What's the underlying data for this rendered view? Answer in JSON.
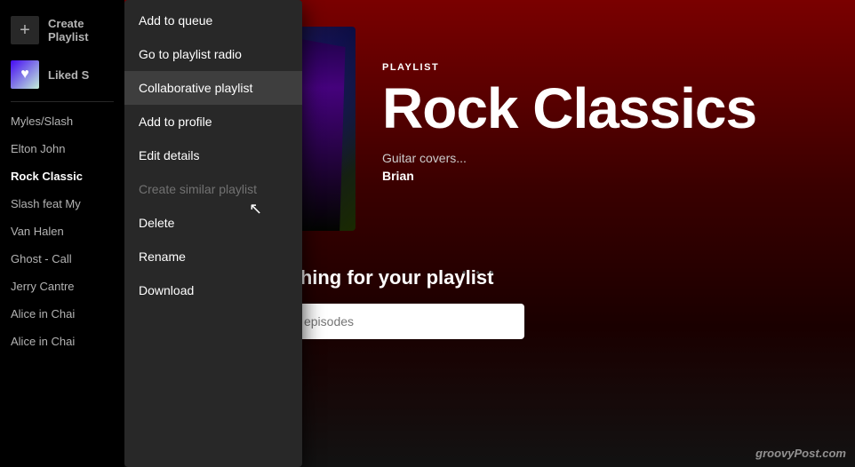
{
  "sidebar": {
    "create_playlist_label": "Create Playlist",
    "liked_songs_label": "Liked S",
    "items": [
      {
        "label": "Myles/Slash",
        "active": false
      },
      {
        "label": "Elton John",
        "active": false
      },
      {
        "label": "Rock Classic",
        "active": true
      },
      {
        "label": "Slash feat My",
        "active": false
      },
      {
        "label": "Van Halen",
        "active": false
      },
      {
        "label": "Ghost - Call",
        "active": false
      },
      {
        "label": "Jerry Cantre",
        "active": false
      },
      {
        "label": "Alice in Chai",
        "active": false
      },
      {
        "label": "Alice in Chai",
        "active": false
      }
    ]
  },
  "playlist": {
    "type": "PLAYLIST",
    "title": "Rock Classics",
    "description": "Guitar covers...",
    "owner": "Brian"
  },
  "context_menu": {
    "items": [
      {
        "label": "Add to queue",
        "disabled": false,
        "active": false
      },
      {
        "label": "Go to playlist radio",
        "disabled": false,
        "active": false
      },
      {
        "label": "Collaborative playlist",
        "disabled": false,
        "active": true
      },
      {
        "label": "Add to profile",
        "disabled": false,
        "active": false
      },
      {
        "label": "Edit details",
        "disabled": false,
        "active": false
      },
      {
        "label": "Create similar playlist",
        "disabled": true,
        "active": false
      },
      {
        "label": "Delete",
        "disabled": false,
        "active": false
      },
      {
        "label": "Rename",
        "disabled": false,
        "active": false
      },
      {
        "label": "Download",
        "disabled": false,
        "active": false
      }
    ]
  },
  "content": {
    "find_label": "et's find something for your playlist",
    "search_placeholder": "Search for songs or episodes"
  },
  "watermark": {
    "text": "groovyPost.com"
  }
}
